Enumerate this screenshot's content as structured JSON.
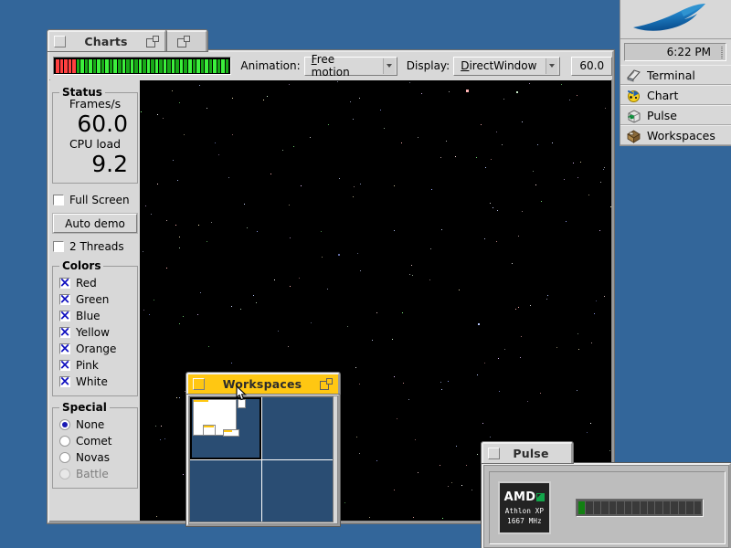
{
  "desktop": {
    "background_color": "#33669a"
  },
  "charts_window": {
    "title": "Charts",
    "second_tab_title": "",
    "toolbar": {
      "animation_label": "Animation:",
      "animation_value": "Free motion",
      "animation_accel": "F",
      "display_label": "Display:",
      "display_value": "DirectWindow",
      "display_accel": "D",
      "fps_field_value": "60.0"
    },
    "status": {
      "group_title": "Status",
      "frames_label": "Frames/s",
      "frames_value": "60.0",
      "cpu_label": "CPU load",
      "cpu_value": "9.2"
    },
    "full_screen": {
      "label": "Full Screen",
      "checked": false
    },
    "auto_demo": {
      "label": "Auto demo"
    },
    "two_threads": {
      "label": "2 Threads",
      "checked": false
    },
    "colors": {
      "group_title": "Colors",
      "items": [
        {
          "label": "Red",
          "checked": true
        },
        {
          "label": "Green",
          "checked": true
        },
        {
          "label": "Blue",
          "checked": true
        },
        {
          "label": "Yellow",
          "checked": true
        },
        {
          "label": "Orange",
          "checked": true
        },
        {
          "label": "Pink",
          "checked": true
        },
        {
          "label": "White",
          "checked": true
        }
      ]
    },
    "special": {
      "group_title": "Special",
      "items": [
        {
          "label": "None",
          "selected": true,
          "enabled": true
        },
        {
          "label": "Comet",
          "selected": false,
          "enabled": true
        },
        {
          "label": "Novas",
          "selected": false,
          "enabled": true
        },
        {
          "label": "Battle",
          "selected": false,
          "enabled": false
        }
      ]
    },
    "led_meter": {
      "total_segments": 42,
      "red_segments": 5,
      "red_color": "#ff4040",
      "green_bright": "#3cf03c",
      "green_dark": "#17a817"
    }
  },
  "workspaces_window": {
    "title": "Workspaces",
    "active_index": 0,
    "rows": 2,
    "columns": 2,
    "cell_color": "#2a4d73",
    "titlebar_color": "#ffc712"
  },
  "pulse_window": {
    "title": "Pulse",
    "cpu": {
      "vendor": "AMD",
      "model": "Athlon XP",
      "clock": "1667 MHz"
    },
    "load_bar": {
      "segments": 16,
      "active_segments": 1,
      "active_color": "#128012"
    }
  },
  "deskbar": {
    "logo_icon": "haiku-feather-icon",
    "clock": "6:22 PM",
    "items": [
      {
        "label": "Terminal",
        "icon": "terminal-icon"
      },
      {
        "label": "Chart",
        "icon": "chart-icon"
      },
      {
        "label": "Pulse",
        "icon": "pulse-icon"
      },
      {
        "label": "Workspaces",
        "icon": "workspaces-icon"
      }
    ]
  }
}
